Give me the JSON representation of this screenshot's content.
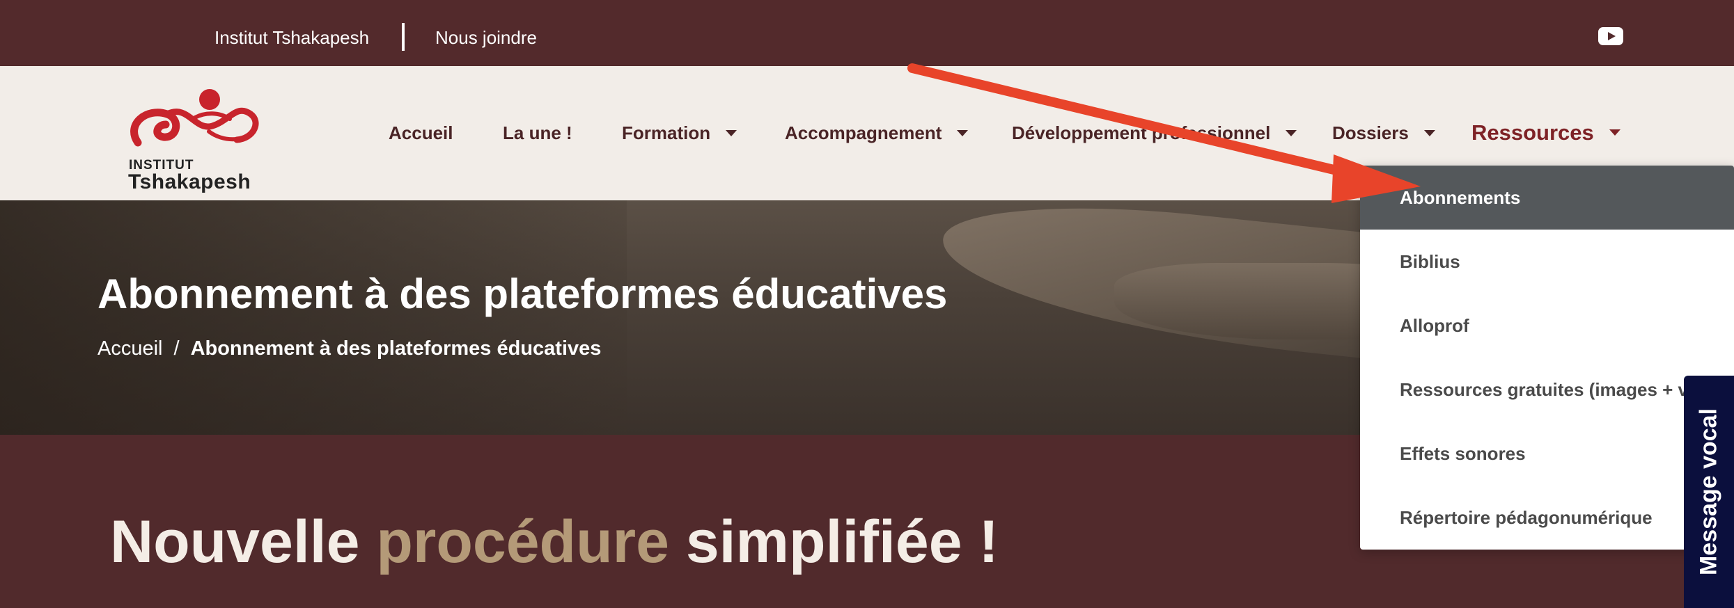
{
  "topbar": {
    "link_institut": "Institut Tshakapesh",
    "link_contact": "Nous joindre",
    "social_icon": "youtube-icon"
  },
  "logo": {
    "line1": "INSTITUT",
    "line2": "Tshakapesh",
    "icon": "institut-tshakapesh-logo-icon"
  },
  "nav": {
    "items": [
      {
        "label": "Accueil"
      },
      {
        "label": "La une !"
      },
      {
        "label": "Formation"
      },
      {
        "label": "Accompagnement"
      },
      {
        "label": "Développement professionnel"
      },
      {
        "label": "Dossiers"
      },
      {
        "label": "Ressources"
      }
    ]
  },
  "dropdown": {
    "items": [
      {
        "label": "Abonnements"
      },
      {
        "label": "Biblius"
      },
      {
        "label": "Alloprof"
      },
      {
        "label": "Ressources gratuites (images + vid"
      },
      {
        "label": "Effets sonores"
      },
      {
        "label": "Répertoire pédagonumérique"
      }
    ]
  },
  "hero": {
    "title": "Abonnement à des plateformes éducatives",
    "breadcrumb_home": "Accueil",
    "breadcrumb_sep": "/",
    "breadcrumb_current": "Abonnement à des plateformes éducatives"
  },
  "section": {
    "heading_part1": "Nouvelle",
    "heading_accent": "procédure",
    "heading_part2": "simplifiée !"
  },
  "vocal_tab": {
    "label": "Message vocal"
  },
  "colors": {
    "brand_dark": "#532a2c",
    "header_bg": "#f2ede8",
    "nav_active": "#7e2226",
    "accent_text": "#b49a78",
    "dropdown_selected": "#54585b",
    "vocal_bg": "#0b0f3d",
    "annotation_arrow": "#e8442a"
  }
}
